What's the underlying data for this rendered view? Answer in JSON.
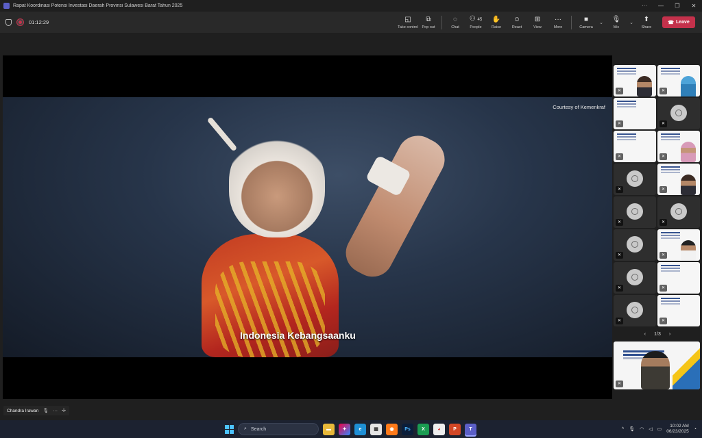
{
  "window": {
    "title": "Rapat Koordinasi Potensi Investasi Daerah Provinsi Sulawesi Barat Tahun 2025",
    "controls": [
      "···",
      "—",
      "❐",
      "✕"
    ]
  },
  "meeting": {
    "timer": "01:12:29",
    "toolbar": [
      {
        "name": "take-control",
        "icon": "◱",
        "label": "Take control"
      },
      {
        "name": "pop-out",
        "icon": "⧉",
        "label": "Pop out"
      },
      {
        "name": "chat",
        "icon": "◌",
        "label": "Chat"
      },
      {
        "name": "people",
        "icon": "⚇",
        "label": "People",
        "count": "45"
      },
      {
        "name": "raise",
        "icon": "✋",
        "label": "Raise"
      },
      {
        "name": "react",
        "icon": "☺",
        "label": "React"
      },
      {
        "name": "view",
        "icon": "⊞",
        "label": "View"
      },
      {
        "name": "more",
        "icon": "···",
        "label": "More"
      }
    ],
    "camera_label": "Camera",
    "mic_label": "Mic",
    "share_label": "Share",
    "leave_label": "Leave"
  },
  "shared_content": {
    "courtesy": "Courtesy of Kemenkraf",
    "subtitle": "Indonesia Kebangsaanku"
  },
  "gallery": {
    "page": "1/3",
    "prev": "‹",
    "next": "›"
  },
  "presenter": {
    "name": "Chandra Irawan"
  },
  "taskbar": {
    "search_placeholder": "Search",
    "time": "10:02 AM",
    "date": "06/23/2025"
  }
}
